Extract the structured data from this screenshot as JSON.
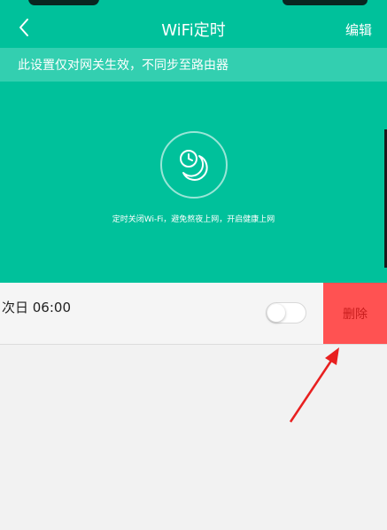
{
  "header": {
    "back_icon": "back-chevron-icon",
    "title": "WiFi定时",
    "edit_label": "编辑"
  },
  "notice": "此设置仅对网关生效，不同步至路由器",
  "hero": {
    "icon": "clock-moon-icon",
    "description": "定时关闭Wi-Fi，避免熬夜上网，开启健康上网"
  },
  "schedule": {
    "time": "次日 06:00",
    "enabled": false,
    "delete_label": "删除"
  },
  "colors": {
    "primary": "#00c19b",
    "notice_bg": "#33cfb0",
    "delete_bg": "#ff5252",
    "annotation_arrow": "#e82020"
  }
}
